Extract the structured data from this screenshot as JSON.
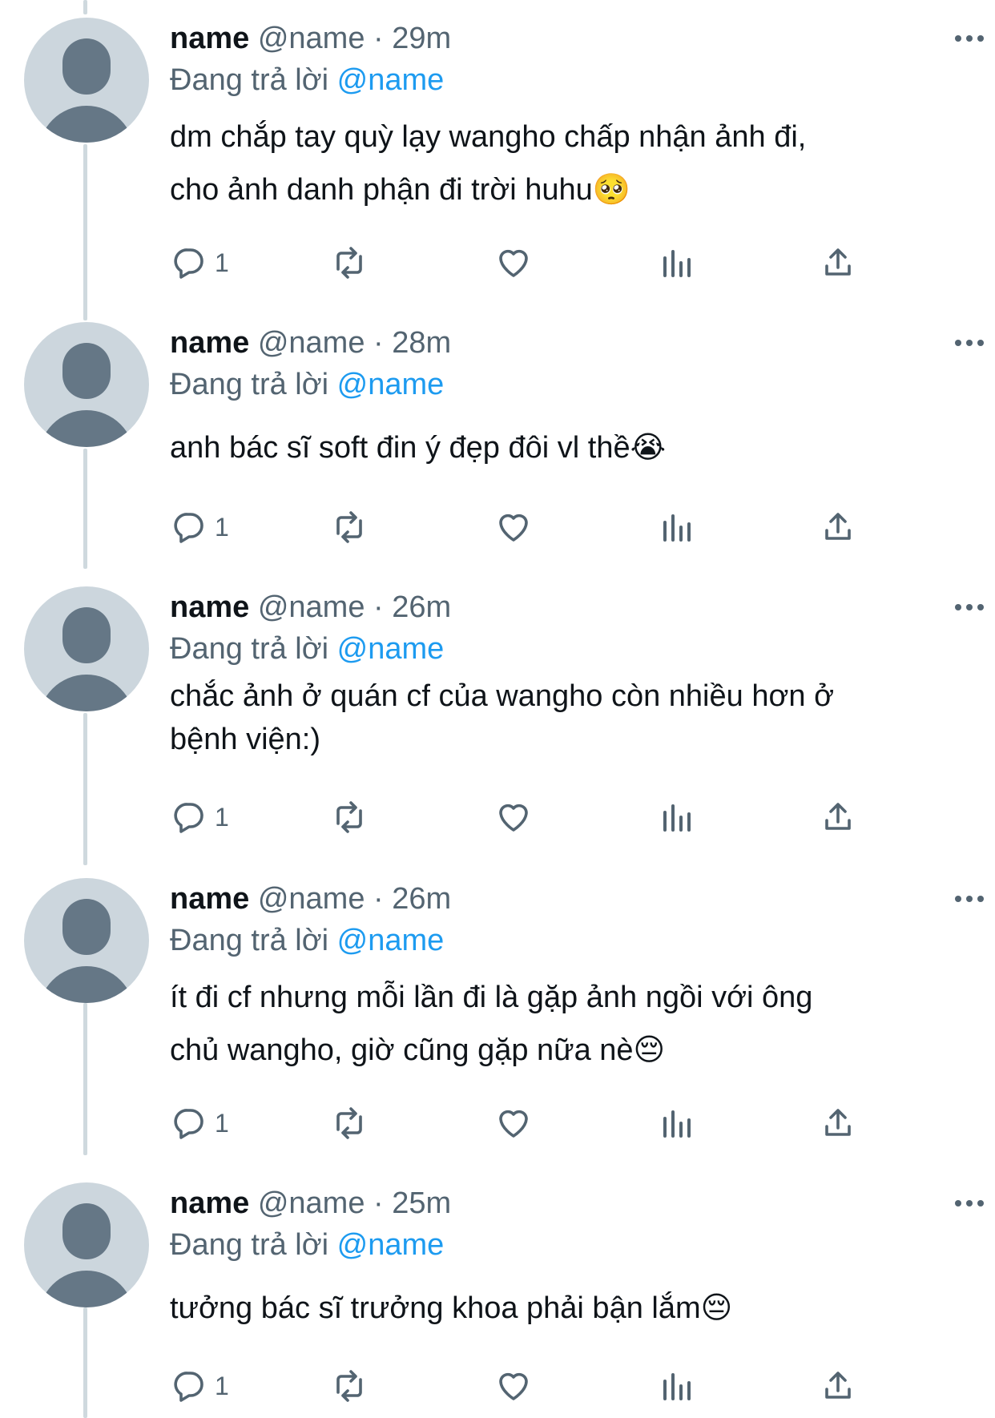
{
  "tweets": [
    {
      "display_name": "name",
      "handle": "@name",
      "separator": "·",
      "time": "29m",
      "reply_prefix": "Đang trả lời",
      "reply_to": "@name",
      "lines": [
        "dm chắp tay quỳ lạy wangho chấp nhận ảnh đi,",
        "cho ảnh danh phận đi trời huhu🥺"
      ],
      "reply_count": "1"
    },
    {
      "display_name": "name",
      "handle": "@name",
      "separator": "·",
      "time": "28m",
      "reply_prefix": "Đang trả lời",
      "reply_to": "@name",
      "lines": [
        "anh bác sĩ soft đin ý đẹp đôi vl thề😭"
      ],
      "reply_count": "1"
    },
    {
      "display_name": "name",
      "handle": "@name",
      "separator": "·",
      "time": "26m",
      "reply_prefix": "Đang trả lời",
      "reply_to": "@name",
      "lines": [
        "chắc ảnh ở quán cf của wangho còn nhiều hơn ở",
        "bệnh viện:)"
      ],
      "reply_count": "1"
    },
    {
      "display_name": "name",
      "handle": "@name",
      "separator": "·",
      "time": "26m",
      "reply_prefix": "Đang trả lời",
      "reply_to": "@name",
      "lines": [
        "ít đi cf nhưng mỗi lần đi là gặp ảnh ngồi với ông",
        "chủ wangho, giờ cũng gặp nữa nè😔"
      ],
      "reply_count": "1"
    },
    {
      "display_name": "name",
      "handle": "@name",
      "separator": "·",
      "time": "25m",
      "reply_prefix": "Đang trả lời",
      "reply_to": "@name",
      "lines": [
        "tưởng bác sĩ trưởng khoa phải bận lắm😔"
      ],
      "reply_count": "1"
    }
  ],
  "icons": {
    "reply": "reply-icon",
    "retweet": "retweet-icon",
    "like": "heart-icon",
    "views": "views-icon",
    "share": "share-icon",
    "more": "more-icon"
  },
  "colors": {
    "text": "#0f1419",
    "secondary": "#536471",
    "link": "#1d9bf0",
    "avatar_bg": "#ccd6dd",
    "avatar_fg": "#657786",
    "thread_line": "#cfd9de"
  }
}
